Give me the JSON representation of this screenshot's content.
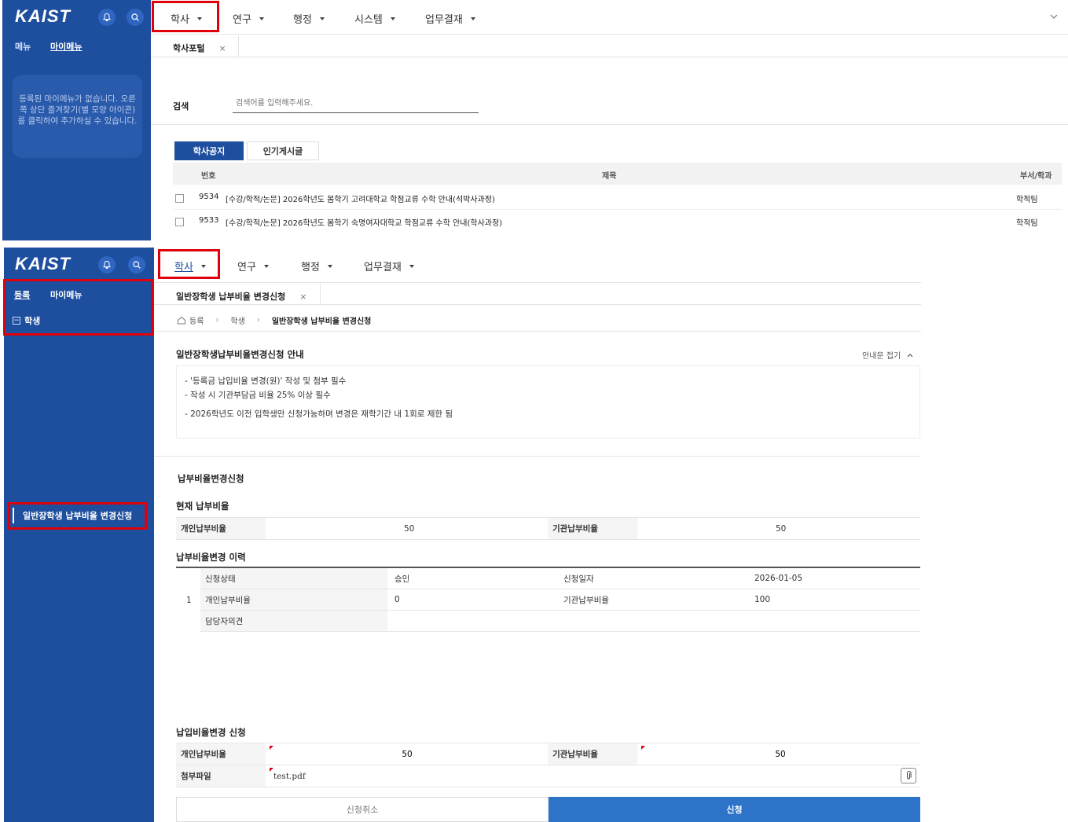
{
  "brand": "KAIST",
  "panel1": {
    "sidebar": {
      "tabs": [
        "메뉴",
        "마이메뉴"
      ],
      "empty_message": "등록된 마이메뉴가 없습니다. 오른쪽 상단 즐겨찾기(별 모양 아이콘)를 클릭하여 추가하실 수 있습니다."
    },
    "nav": [
      "학사",
      "연구",
      "행정",
      "시스템",
      "업무결재"
    ],
    "tab": {
      "label": "학사포털",
      "close": "×"
    },
    "search": {
      "label": "검색",
      "placeholder": "검색어를 입력해주세요."
    },
    "notice_tabs": [
      "학사공지",
      "인기게시글"
    ],
    "table": {
      "headers": {
        "no": "번호",
        "title": "제목",
        "dept": "부서/학과"
      },
      "rows": [
        {
          "no": "9534",
          "title": "[수강/학적/논문] 2026학년도 봄학기 고려대학교 학점교류 수학 안내(석박사과정)",
          "dept": "학적팀"
        },
        {
          "no": "9533",
          "title": "[수강/학적/논문] 2026학년도 봄학기 숙명여자대학교 학점교류 수학 안내(학사과정)",
          "dept": "학적팀"
        }
      ]
    }
  },
  "panel2": {
    "sidebar": {
      "tabs": [
        "등록",
        "마이메뉴"
      ],
      "tree_root": "학생",
      "tree_sign": "−",
      "menu_item": "일반장학생 납부비율 변경신청"
    },
    "nav": [
      "학사",
      "연구",
      "행정",
      "업무결재"
    ],
    "tab": {
      "label": "일반장학생 납부비율 변경신청",
      "close": "×"
    },
    "breadcrumb": [
      "등록",
      "학생",
      "일반장학생 납부비율 변경신청"
    ],
    "guide": {
      "title": "일반장학생납부비율변경신청 안내",
      "toggle": "안내문 접기",
      "lines": [
        "- '등록금 납입비율 변경(원)' 작성 및 첨부 필수",
        "- 작성 시 기관부담금 비율 25% 이상 필수",
        "- 2026학년도 이전 입학생만 신청가능하며 변경은 재학기간 내 1회로 제한 됨"
      ]
    },
    "section_main": "납부비율변경신청",
    "current": {
      "title": "현재 납부비율",
      "personal_label": "개인납부비율",
      "personal_value": "50",
      "inst_label": "기관납부비율",
      "inst_value": "50"
    },
    "history": {
      "title": "납부비율변경 이력",
      "row_no": "1",
      "status_label": "신청상태",
      "status_value": "승인",
      "date_label": "신청일자",
      "date_value": "2026-01-05",
      "personal_label": "개인납부비율",
      "personal_value": "0",
      "inst_label": "기관납부비율",
      "inst_value": "100",
      "opinion_label": "담당자의견",
      "opinion_value": ""
    },
    "apply": {
      "title": "납입비율변경 신청",
      "personal_label": "개인납부비율",
      "personal_value": "50",
      "inst_label": "기관납부비율",
      "inst_value": "50",
      "file_label": "첨부파일",
      "file_value": "test.pdf",
      "cancel": "신청취소",
      "submit": "신청"
    }
  },
  "colors": {
    "sidebar": "#1e4e9e",
    "accent": "#2d74c9",
    "highlight": "#e0000b"
  }
}
